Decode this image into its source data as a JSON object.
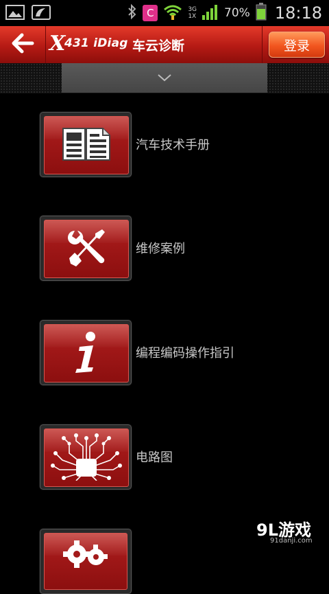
{
  "status_bar": {
    "icons_left": [
      "gallery-icon",
      "tv-dish-icon"
    ],
    "icons_right": [
      "bluetooth-icon",
      "app-c-icon",
      "wifi-icon",
      "signal-icon",
      "battery-icon"
    ],
    "app_letter": "C",
    "network_label_top": "3G",
    "network_label_bottom": "1X",
    "battery_percent": "70%",
    "time": "18:18"
  },
  "header": {
    "logo_mark": "X",
    "logo_text": "431 iDiag",
    "title": "车云诊断",
    "login_label": "登录",
    "accent_color": "#c2211a"
  },
  "menu": {
    "items": [
      {
        "label": "汽车技术手册",
        "icon": "manual-book-icon"
      },
      {
        "label": "维修案例",
        "icon": "wrench-screwdriver-icon"
      },
      {
        "label": "编程编码操作指引",
        "icon": "info-icon"
      },
      {
        "label": "电路图",
        "icon": "circuit-board-icon"
      },
      {
        "label": "",
        "icon": "gears-icon"
      }
    ]
  },
  "watermark": {
    "logo": "9L游戏",
    "url": "91danji.com"
  }
}
